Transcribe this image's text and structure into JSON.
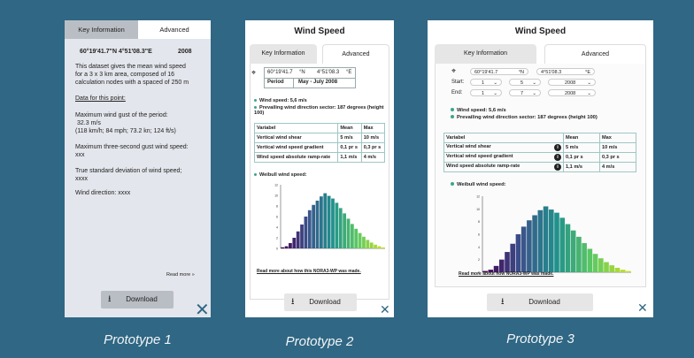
{
  "captions": [
    "Prototype 1",
    "Prototype 2",
    "Prototype 3"
  ],
  "p1": {
    "tab_key": "Key Information",
    "tab_adv": "Advanced",
    "coords": "60°19'41.7\"N  4°51'08.3\"E",
    "year": "2008",
    "desc": [
      "This dataset gives the mean wind speed",
      "for a 3 x 3 km area, composed of 16",
      "calculation nodes with a spaced of 250 m"
    ],
    "data_link": "Data for this point:",
    "gust_label": "Maximum wind gust of the period:",
    "gust_values": [
      "32.3 m/s",
      "(118 km/h; 84 mph; 73.2 kn; 124 ft/s)"
    ],
    "three_sec": "Maximum three-second gust wind speed:",
    "three_sec_val": "xxx",
    "std_label": "True standard deviation of wind speed;",
    "std_val": "xxxx",
    "direction": "Wind direction: xxxx",
    "read_more": "Read more »",
    "download": "Download"
  },
  "p2": {
    "title": "Wind Speed",
    "tab_key": "Key Information",
    "tab_adv": "Advanced",
    "lat": "60°19'41.7",
    "lat_unit": "°N",
    "lon": "4°51'08.3",
    "lon_unit": "°E",
    "period_label": "Period",
    "period_value": "May - July  2008",
    "wind_speed": "Wind speed: 5,6 m/s",
    "sector": "Prevailing wind direction sector: 187 degrees (height 100)",
    "table_header": [
      "Variabel",
      "Mean",
      "Max"
    ],
    "table_rows": [
      [
        "Vertical wind shear",
        "5 m/s",
        "10 m/s"
      ],
      [
        "Vertical wind speed gradient",
        "0,1 pr s",
        "0,3 pr s"
      ],
      [
        "Wind speed absolute ramp-rate",
        "1,1 m/s",
        "4 m/s"
      ]
    ],
    "weibull_label": "Weibull wind speed:",
    "read_more": "Read more about how this NORA3-WP was made.",
    "download": "Download"
  },
  "p3": {
    "title": "Wind Speed",
    "tab_key": "Key Information",
    "tab_adv": "Advanced",
    "lat": "60°19'41.7",
    "lat_unit": "°N",
    "lon": "4°51'08.3",
    "lon_unit": "°E",
    "start_label": "Start:",
    "end_label": "End:",
    "start_day": "1",
    "start_month": "5",
    "start_year": "2008",
    "end_day": "1",
    "end_month": "7",
    "end_year": "2008",
    "wind_speed": "Wind speed: 5,6 m/s",
    "sector": "Prevailing wind direction sector: 187 degrees (height 100)",
    "table_header": [
      "Variabel",
      "Mean",
      "Max"
    ],
    "table_rows": [
      [
        "Vertical wind shear",
        "5 m/s",
        "10 m/s"
      ],
      [
        "Vertical wind speed gradient",
        "0,1 pr s",
        "0,3 pr s"
      ],
      [
        "Wind speed absolute ramp-rate",
        "1,1 m/s",
        "4 m/s"
      ]
    ],
    "weibull_label": "Weibull wind speed:",
    "read_more": "Read more about how NORA3-WP was made.",
    "download": "Download"
  },
  "chart_data": [
    {
      "type": "bar",
      "y_ticks": [
        "0",
        "2",
        "4",
        "6",
        "8",
        "10",
        "12"
      ],
      "ylim": [
        0,
        12
      ],
      "values": [
        0.2,
        0.4,
        1.0,
        2.0,
        3.2,
        4.5,
        6.0,
        7.2,
        8.2,
        9.0,
        9.8,
        10.4,
        9.9,
        9.4,
        8.6,
        7.6,
        6.6,
        5.6,
        4.6,
        3.7,
        2.9,
        2.2,
        1.6,
        1.1,
        0.7,
        0.4,
        0.2
      ]
    },
    {
      "type": "bar",
      "y_ticks": [
        "0",
        "2",
        "4",
        "6",
        "8",
        "10",
        "12"
      ],
      "ylim": [
        0,
        12
      ],
      "values": [
        0.2,
        0.4,
        1.0,
        2.0,
        3.2,
        4.5,
        6.0,
        7.2,
        8.2,
        9.0,
        9.8,
        10.4,
        9.9,
        9.4,
        8.6,
        7.6,
        6.6,
        5.6,
        4.6,
        3.7,
        2.9,
        2.2,
        1.6,
        1.1,
        0.7,
        0.4,
        0.2
      ]
    }
  ],
  "colors": {
    "background": "#2f6784",
    "accent": "#2f6784",
    "tab_active": "#b9bec4",
    "panel": "#e3e6ec"
  },
  "icons": [
    "location-pin-icon",
    "chevron-down-icon",
    "info-icon",
    "download-icon",
    "close-icon"
  ]
}
